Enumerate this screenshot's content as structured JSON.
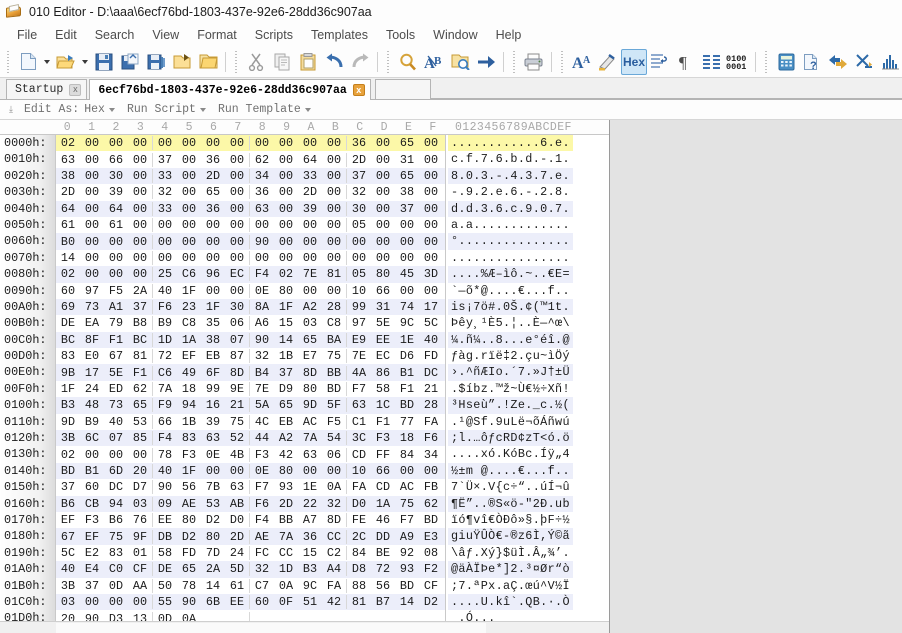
{
  "window": {
    "title": "010 Editor - D:\\aaa\\6ecf76bd-1803-437e-92e6-28dd36c907aa",
    "app_icon": "book-icon"
  },
  "menubar": {
    "items": [
      {
        "label": "File"
      },
      {
        "label": "Edit"
      },
      {
        "label": "Search"
      },
      {
        "label": "View"
      },
      {
        "label": "Format"
      },
      {
        "label": "Scripts"
      },
      {
        "label": "Templates"
      },
      {
        "label": "Tools"
      },
      {
        "label": "Window"
      },
      {
        "label": "Help"
      }
    ]
  },
  "toolbar": {
    "hex_label": "Hex",
    "binary_label_top": "0100",
    "binary_label_bottom": "0001",
    "buttons": [
      {
        "name": "new-file-icon"
      },
      {
        "name": "open-file-icon"
      },
      {
        "name": "save-icon"
      },
      {
        "name": "save-as-icon"
      },
      {
        "name": "save-all-icon"
      },
      {
        "name": "open-folder-icon"
      },
      {
        "name": "folder-icon"
      },
      {
        "name": "cut-icon"
      },
      {
        "name": "copy-icon"
      },
      {
        "name": "paste-icon"
      },
      {
        "name": "undo-icon"
      },
      {
        "name": "redo-icon"
      },
      {
        "name": "find-icon"
      },
      {
        "name": "replace-icon"
      },
      {
        "name": "find-in-files-icon"
      },
      {
        "name": "goto-icon"
      },
      {
        "name": "print-icon"
      },
      {
        "name": "font-icon"
      },
      {
        "name": "highlight-icon"
      },
      {
        "name": "hex-toggle-icon"
      },
      {
        "name": "line-wrap-icon"
      },
      {
        "name": "paragraph-icon"
      },
      {
        "name": "columns-icon"
      },
      {
        "name": "binary-icon"
      },
      {
        "name": "calculator-icon"
      },
      {
        "name": "file-info-icon"
      },
      {
        "name": "compare-icon"
      },
      {
        "name": "checksum-icon"
      },
      {
        "name": "histogram-icon"
      },
      {
        "name": "verify-icon"
      }
    ]
  },
  "tabs": [
    {
      "label": "Startup",
      "active": false,
      "close_label": "x"
    },
    {
      "label": "6ecf76bd-1803-437e-92e6-28dd36c907aa",
      "active": true,
      "close_label": "x"
    }
  ],
  "editbar": {
    "grip": "⤓",
    "edit_as_label": "Edit As:",
    "edit_as_value": "Hex",
    "run_script_label": "Run Script",
    "run_template_label": "Run Template"
  },
  "hexview": {
    "column_headers": [
      "0",
      "1",
      "2",
      "3",
      "4",
      "5",
      "6",
      "7",
      "8",
      "9",
      "A",
      "B",
      "C",
      "D",
      "E",
      "F"
    ],
    "ascii_header": "0123456789ABCDEF",
    "rows": [
      {
        "offset": "0000h:",
        "bytes": [
          "02",
          "00",
          "00",
          "00",
          "00",
          "00",
          "00",
          "00",
          "00",
          "00",
          "00",
          "00",
          "36",
          "00",
          "65",
          "00"
        ],
        "ascii": "............6.e.",
        "selected": true
      },
      {
        "offset": "0010h:",
        "bytes": [
          "63",
          "00",
          "66",
          "00",
          "37",
          "00",
          "36",
          "00",
          "62",
          "00",
          "64",
          "00",
          "2D",
          "00",
          "31",
          "00"
        ],
        "ascii": "c.f.7.6.b.d.-.1.",
        "selected": false
      },
      {
        "offset": "0020h:",
        "bytes": [
          "38",
          "00",
          "30",
          "00",
          "33",
          "00",
          "2D",
          "00",
          "34",
          "00",
          "33",
          "00",
          "37",
          "00",
          "65",
          "00"
        ],
        "ascii": "8.0.3.-.4.3.7.e.",
        "selected": false
      },
      {
        "offset": "0030h:",
        "bytes": [
          "2D",
          "00",
          "39",
          "00",
          "32",
          "00",
          "65",
          "00",
          "36",
          "00",
          "2D",
          "00",
          "32",
          "00",
          "38",
          "00"
        ],
        "ascii": "-.9.2.e.6.-.2.8.",
        "selected": false
      },
      {
        "offset": "0040h:",
        "bytes": [
          "64",
          "00",
          "64",
          "00",
          "33",
          "00",
          "36",
          "00",
          "63",
          "00",
          "39",
          "00",
          "30",
          "00",
          "37",
          "00"
        ],
        "ascii": "d.d.3.6.c.9.0.7.",
        "selected": false
      },
      {
        "offset": "0050h:",
        "bytes": [
          "61",
          "00",
          "61",
          "00",
          "00",
          "00",
          "00",
          "00",
          "00",
          "00",
          "00",
          "00",
          "05",
          "00",
          "00",
          "00"
        ],
        "ascii": "a.a.............",
        "selected": false
      },
      {
        "offset": "0060h:",
        "bytes": [
          "B0",
          "00",
          "00",
          "00",
          "00",
          "00",
          "00",
          "00",
          "90",
          "00",
          "00",
          "00",
          "00",
          "00",
          "00",
          "00"
        ],
        "ascii": "°...............",
        "selected": false
      },
      {
        "offset": "0070h:",
        "bytes": [
          "14",
          "00",
          "00",
          "00",
          "00",
          "00",
          "00",
          "00",
          "00",
          "00",
          "00",
          "00",
          "00",
          "00",
          "00",
          "00"
        ],
        "ascii": "................",
        "selected": false
      },
      {
        "offset": "0080h:",
        "bytes": [
          "02",
          "00",
          "00",
          "00",
          "25",
          "C6",
          "96",
          "EC",
          "F4",
          "02",
          "7E",
          "81",
          "05",
          "80",
          "45",
          "3D"
        ],
        "ascii": "....%Æ–ìô.~..€E=",
        "selected": false
      },
      {
        "offset": "0090h:",
        "bytes": [
          "60",
          "97",
          "F5",
          "2A",
          "40",
          "1F",
          "00",
          "00",
          "0E",
          "80",
          "00",
          "00",
          "10",
          "66",
          "00",
          "00"
        ],
        "ascii": "`—õ*@....€...f..",
        "selected": false
      },
      {
        "offset": "00A0h:",
        "bytes": [
          "69",
          "73",
          "A1",
          "37",
          "F6",
          "23",
          "1F",
          "30",
          "8A",
          "1F",
          "A2",
          "28",
          "99",
          "31",
          "74",
          "17"
        ],
        "ascii": "is¡7ö#.0Š.¢(™1t.",
        "selected": false
      },
      {
        "offset": "00B0h:",
        "bytes": [
          "DE",
          "EA",
          "79",
          "B8",
          "B9",
          "C8",
          "35",
          "06",
          "A6",
          "15",
          "03",
          "C8",
          "97",
          "5E",
          "9C",
          "5C"
        ],
        "ascii": "Þêy¸¹È5.¦..È—^œ\\",
        "selected": false
      },
      {
        "offset": "00C0h:",
        "bytes": [
          "BC",
          "8F",
          "F1",
          "BC",
          "1D",
          "1A",
          "38",
          "07",
          "90",
          "14",
          "65",
          "BA",
          "E9",
          "EE",
          "1E",
          "40"
        ],
        "ascii": "¼.ñ¼..8...e°éî.@",
        "selected": false
      },
      {
        "offset": "00D0h:",
        "bytes": [
          "83",
          "E0",
          "67",
          "81",
          "72",
          "EF",
          "EB",
          "87",
          "32",
          "1B",
          "E7",
          "75",
          "7E",
          "EC",
          "D6",
          "FD"
        ],
        "ascii": "ƒàg.rïë‡2.çu~ìÖý",
        "selected": false
      },
      {
        "offset": "00E0h:",
        "bytes": [
          "9B",
          "17",
          "5E",
          "F1",
          "C6",
          "49",
          "6F",
          "8D",
          "B4",
          "37",
          "8D",
          "BB",
          "4A",
          "86",
          "B1",
          "DC"
        ],
        "ascii": "›.^ñÆIo.´7.»J†±Ü",
        "selected": false
      },
      {
        "offset": "00F0h:",
        "bytes": [
          "1F",
          "24",
          "ED",
          "62",
          "7A",
          "18",
          "99",
          "9E",
          "7E",
          "D9",
          "80",
          "BD",
          "F7",
          "58",
          "F1",
          "21"
        ],
        "ascii": ".$íbz.™ž~Ù€½÷Xñ!",
        "selected": false
      },
      {
        "offset": "0100h:",
        "bytes": [
          "B3",
          "48",
          "73",
          "65",
          "F9",
          "94",
          "16",
          "21",
          "5A",
          "65",
          "9D",
          "5F",
          "63",
          "1C",
          "BD",
          "28"
        ],
        "ascii": "³Hseù”.!Ze._c.½(",
        "selected": false
      },
      {
        "offset": "0110h:",
        "bytes": [
          "9D",
          "B9",
          "40",
          "53",
          "66",
          "1B",
          "39",
          "75",
          "4C",
          "EB",
          "AC",
          "F5",
          "C1",
          "F1",
          "77",
          "FA"
        ],
        "ascii": ".¹@Sf.9uLë¬õÁñwú",
        "selected": false
      },
      {
        "offset": "0120h:",
        "bytes": [
          "3B",
          "6C",
          "07",
          "85",
          "F4",
          "83",
          "63",
          "52",
          "44",
          "A2",
          "7A",
          "54",
          "3C",
          "F3",
          "18",
          "F6"
        ],
        "ascii": ";l.…ôƒcRD¢zT<ó.ö",
        "selected": false
      },
      {
        "offset": "0130h:",
        "bytes": [
          "02",
          "00",
          "00",
          "00",
          "78",
          "F3",
          "0E",
          "4B",
          "F3",
          "42",
          "63",
          "06",
          "CD",
          "FF",
          "84",
          "34"
        ],
        "ascii": "....xó.KóBc.Íÿ„4",
        "selected": false
      },
      {
        "offset": "0140h:",
        "bytes": [
          "BD",
          "B1",
          "6D",
          "20",
          "40",
          "1F",
          "00",
          "00",
          "0E",
          "80",
          "00",
          "00",
          "10",
          "66",
          "00",
          "00"
        ],
        "ascii": "½±m @....€...f..",
        "selected": false
      },
      {
        "offset": "0150h:",
        "bytes": [
          "37",
          "60",
          "DC",
          "D7",
          "90",
          "56",
          "7B",
          "63",
          "F7",
          "93",
          "1E",
          "0A",
          "FA",
          "CD",
          "AC",
          "FB"
        ],
        "ascii": "7`Ü×.V{c÷“..úÍ¬û",
        "selected": false
      },
      {
        "offset": "0160h:",
        "bytes": [
          "B6",
          "CB",
          "94",
          "03",
          "09",
          "AE",
          "53",
          "AB",
          "F6",
          "2D",
          "22",
          "32",
          "D0",
          "1A",
          "75",
          "62"
        ],
        "ascii": "¶Ë”..®S«ö-\"2Ð.ub",
        "selected": false
      },
      {
        "offset": "0170h:",
        "bytes": [
          "EF",
          "F3",
          "B6",
          "76",
          "EE",
          "80",
          "D2",
          "D0",
          "F4",
          "BB",
          "A7",
          "8D",
          "FE",
          "46",
          "F7",
          "BD"
        ],
        "ascii": "ïó¶vî€ÒÐô»§.þF÷½",
        "selected": false
      },
      {
        "offset": "0180h:",
        "bytes": [
          "67",
          "EF",
          "75",
          "9F",
          "DB",
          "D2",
          "80",
          "2D",
          "AE",
          "7A",
          "36",
          "CC",
          "2C",
          "DD",
          "A9",
          "E3"
        ],
        "ascii": "giuŸÛÒ€-®z6Ì,Ý©ã",
        "selected": false
      },
      {
        "offset": "0190h:",
        "bytes": [
          "5C",
          "E2",
          "83",
          "01",
          "58",
          "FD",
          "7D",
          "24",
          "FC",
          "CC",
          "15",
          "C2",
          "84",
          "BE",
          "92",
          "08"
        ],
        "ascii": "\\âƒ.Xý}$üÌ.Â„¾’.",
        "selected": false
      },
      {
        "offset": "01A0h:",
        "bytes": [
          "40",
          "E4",
          "C0",
          "CF",
          "DE",
          "65",
          "2A",
          "5D",
          "32",
          "1D",
          "B3",
          "A4",
          "D8",
          "72",
          "93",
          "F2"
        ],
        "ascii": "@äÀÏÞe*]2.³¤Ør“ò",
        "selected": false
      },
      {
        "offset": "01B0h:",
        "bytes": [
          "3B",
          "37",
          "0D",
          "AA",
          "50",
          "78",
          "14",
          "61",
          "C7",
          "0A",
          "9C",
          "FA",
          "88",
          "56",
          "BD",
          "CF"
        ],
        "ascii": ";7.ªPx.aÇ.œú^V½Ï",
        "selected": false
      },
      {
        "offset": "01C0h:",
        "bytes": [
          "03",
          "00",
          "00",
          "00",
          "55",
          "90",
          "6B",
          "EE",
          "60",
          "0F",
          "51",
          "42",
          "81",
          "B7",
          "14",
          "D2"
        ],
        "ascii": "....U.kî`.QB.·.Ò",
        "selected": false
      },
      {
        "offset": "01D0h:",
        "bytes": [
          "20",
          "90",
          "D3",
          "13",
          "0D",
          "0A"
        ],
        "ascii": " .Ó...",
        "selected": false
      }
    ]
  }
}
